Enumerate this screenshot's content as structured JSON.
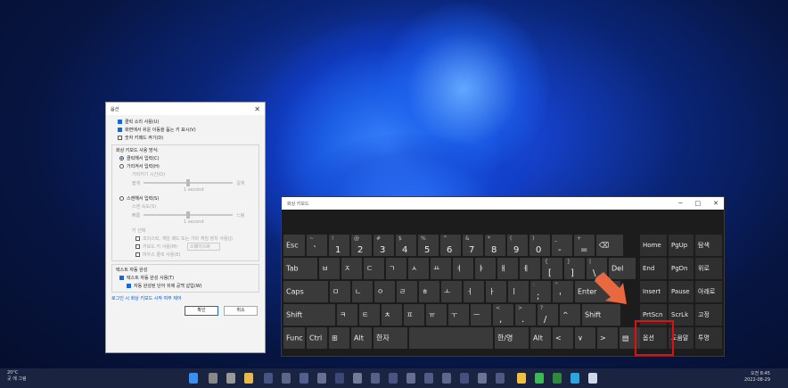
{
  "options_dialog": {
    "title": "옵션",
    "close": "✕",
    "check1": "클릭 소리 사용(U)",
    "check2": "화면에서 쉬운 이동을 돕는 키 표시(V)",
    "check3": "숫자 키패드 켜기(D)",
    "usage_header": "화상 키보드 사용 방식:",
    "radio_click": "클릭해서 입력(C)",
    "radio_hover": "가리켜서 입력(H)",
    "hover_duration": "가리키기 시간(O)",
    "short": "짧게",
    "long": "길게",
    "one_second": "1 second",
    "radio_scan": "스캔해서 입력(S)",
    "scan_speed": "스캔 속도(S)",
    "fast": "빠름",
    "slow": "느림",
    "key_select": "키 선택",
    "joystick": "조이스틱, 게임 패드 또는 기타 게임 장치 사용(J)",
    "keyboard_key": "키보드 키 사용(M)",
    "keyboard_key_value": "스페이스바",
    "mouse_click": "마우스 클릭 사용(E)",
    "text_pred_header": "텍스트 자동 완성",
    "text_pred": "텍스트 자동 완성 사용(T)",
    "insert_space": "자동 완성된 단어 뒤에 공백 삽입(W)",
    "login_link": "로그인 시 화상 키보드 시작 여부 제어",
    "ok": "확인",
    "cancel": "취소"
  },
  "keyboard": {
    "title": "화상 키보드",
    "min": "─",
    "max": "□",
    "close": "✕",
    "row1": [
      {
        "m": "Esc"
      },
      {
        "s": "~",
        "b": "`"
      },
      {
        "s": "!",
        "b": "1"
      },
      {
        "s": "@",
        "b": "2"
      },
      {
        "s": "#",
        "b": "3"
      },
      {
        "s": "$",
        "b": "4"
      },
      {
        "s": "%",
        "b": "5"
      },
      {
        "s": "^",
        "b": "6"
      },
      {
        "s": "&",
        "b": "7"
      },
      {
        "s": "*",
        "b": "8"
      },
      {
        "s": "(",
        "b": "9"
      },
      {
        "s": ")",
        "b": "0"
      },
      {
        "s": "_",
        "b": "-"
      },
      {
        "s": "+",
        "b": "="
      },
      {
        "m": "⌫"
      }
    ],
    "row2": [
      {
        "m": "Tab"
      },
      {
        "m": "ㅂ"
      },
      {
        "m": "ㅈ"
      },
      {
        "m": "ㄷ"
      },
      {
        "m": "ㄱ"
      },
      {
        "m": "ㅅ"
      },
      {
        "m": "ㅛ"
      },
      {
        "m": "ㅕ"
      },
      {
        "m": "ㅑ"
      },
      {
        "m": "ㅐ"
      },
      {
        "m": "ㅔ"
      },
      {
        "s": "{",
        "b": "["
      },
      {
        "s": "}",
        "b": "]"
      },
      {
        "s": "|",
        "b": "\\"
      },
      {
        "m": "Del"
      }
    ],
    "row3": [
      {
        "m": "Caps"
      },
      {
        "m": "ㅁ"
      },
      {
        "m": "ㄴ"
      },
      {
        "m": "ㅇ"
      },
      {
        "m": "ㄹ"
      },
      {
        "m": "ㅎ"
      },
      {
        "m": "ㅗ"
      },
      {
        "m": "ㅓ"
      },
      {
        "m": "ㅏ"
      },
      {
        "m": "ㅣ"
      },
      {
        "s": ":",
        "b": ";"
      },
      {
        "s": "\"",
        "b": "'"
      },
      {
        "m": "Enter"
      }
    ],
    "row4": [
      {
        "m": "Shift"
      },
      {
        "m": "ㅋ"
      },
      {
        "m": "ㅌ"
      },
      {
        "m": "ㅊ"
      },
      {
        "m": "ㅍ"
      },
      {
        "m": "ㅠ"
      },
      {
        "m": "ㅜ"
      },
      {
        "m": "ㅡ"
      },
      {
        "s": "<",
        "b": ","
      },
      {
        "s": ">",
        "b": "."
      },
      {
        "s": "?",
        "b": "/"
      },
      {
        "m": "^"
      },
      {
        "m": "Shift"
      }
    ],
    "row5": [
      {
        "m": "Func"
      },
      {
        "m": "Ctrl"
      },
      {
        "m": "⊞"
      },
      {
        "m": "Alt"
      },
      {
        "m": "한자"
      },
      {
        "m": ""
      },
      {
        "m": "한/영"
      },
      {
        "m": "Alt"
      },
      {
        "m": "<"
      },
      {
        "m": "∨"
      },
      {
        "m": ">"
      },
      {
        "m": "▤"
      }
    ],
    "nav": [
      [
        "Home",
        "PgUp",
        "탐색"
      ],
      [
        "End",
        "PgDn",
        "위로"
      ],
      [
        "Insert",
        "Pause",
        "아래로"
      ],
      [
        "PrtScn",
        "ScrLk",
        "고정"
      ],
      [
        "옵션",
        "도움말",
        "투명"
      ]
    ]
  },
  "taskbar": {
    "weather_temp": "20°C",
    "weather_desc": "곳 에 그림",
    "time": "오전 8:45",
    "date": "2022-08-29"
  }
}
